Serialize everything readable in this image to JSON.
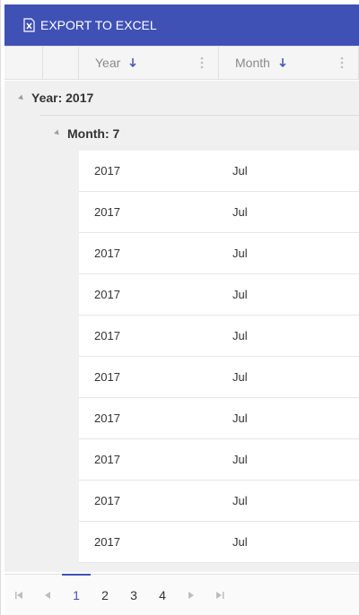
{
  "toolbar": {
    "export_label": "EXPORT TO EXCEL"
  },
  "header": {
    "col_year": "Year",
    "col_month": "Month"
  },
  "groups": {
    "year_label": "Year: 2017",
    "month_label": "Month: 7"
  },
  "rows": [
    {
      "year": "2017",
      "month": "Jul"
    },
    {
      "year": "2017",
      "month": "Jul"
    },
    {
      "year": "2017",
      "month": "Jul"
    },
    {
      "year": "2017",
      "month": "Jul"
    },
    {
      "year": "2017",
      "month": "Jul"
    },
    {
      "year": "2017",
      "month": "Jul"
    },
    {
      "year": "2017",
      "month": "Jul"
    },
    {
      "year": "2017",
      "month": "Jul"
    },
    {
      "year": "2017",
      "month": "Jul"
    },
    {
      "year": "2017",
      "month": "Jul"
    }
  ],
  "pager": {
    "first": "⏮",
    "prev": "◀",
    "pages": [
      "1",
      "2",
      "3",
      "4"
    ],
    "next": "▶",
    "last": "⏭",
    "current": "1"
  },
  "colors": {
    "accent": "#3f51b5"
  }
}
